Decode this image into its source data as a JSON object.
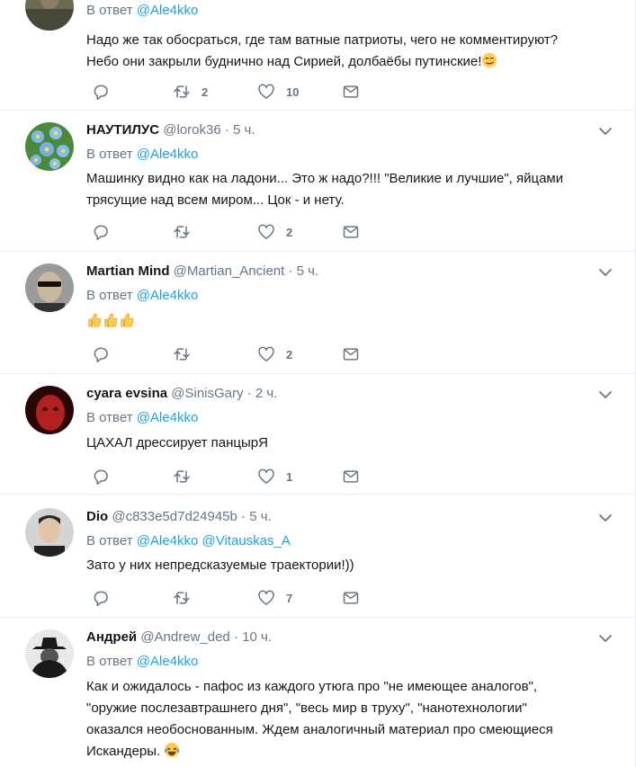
{
  "reply_prefix": "В ответ",
  "tweets": [
    {
      "name": "",
      "handle": "",
      "time": "",
      "mentions": [
        "@Ale4kko"
      ],
      "lines": [
        "Надо же так обосраться, где там ватные патриоты, чего не комментируют?",
        "Небо они закрыли буднично над Сирией,  долбаёбы путинские!"
      ],
      "emoji": "smirk-emoji",
      "retweets": "2",
      "likes": "10",
      "avatar_icon": "soldier-avatar"
    },
    {
      "name": "НАУТИЛУС",
      "handle": "@lorok36",
      "time": "5 ч.",
      "mentions": [
        "@Ale4kko"
      ],
      "lines": [
        "Машинку видно как на ладони... Это ж надо?!!! \"Великие и лучшие\", яйцами",
        "трясущие над всем миром... Цок - и нету."
      ],
      "retweets": "",
      "likes": "2",
      "avatar_icon": "forget-me-not-flowers-avatar"
    },
    {
      "name": "Martian Mind",
      "handle": "@Martian_Ancient",
      "time": "5 ч.",
      "mentions": [
        "@Ale4kko"
      ],
      "lines": [
        ""
      ],
      "emoji": "thumbs-up-emoji-x3",
      "retweets": "",
      "likes": "2",
      "avatar_icon": "sunglasses-man-avatar"
    },
    {
      "name": "cyara evsina",
      "handle": "@SinisGary",
      "time": "2 ч.",
      "mentions": [
        "@Ale4kko"
      ],
      "lines": [
        "ЦАХАЛ дрессирует панцырЯ"
      ],
      "retweets": "",
      "likes": "1",
      "avatar_icon": "red-face-avatar"
    },
    {
      "name": "Dio",
      "handle": "@c833e5d7d24945b",
      "time": "5 ч.",
      "mentions": [
        "@Ale4kko",
        "@Vitauskas_A"
      ],
      "lines": [
        "Зато у них непредсказуемые траектории!))"
      ],
      "retweets": "",
      "likes": "7",
      "avatar_icon": "man-portrait-avatar"
    },
    {
      "name": "Андрей",
      "handle": "@Andrew_ded",
      "time": "10 ч.",
      "mentions": [
        "@Ale4kko"
      ],
      "lines": [
        "Как и ожидалось - пафос из каждого утюга про \"не имеющее аналогов\",",
        "\"оружие послезавтрашнего дня\", \"весь мир в труху\", \"нанотехнологии\"",
        "оказался необоснованным. Ждем аналогичный материал про смеющиеся",
        "Искандеры. "
      ],
      "emoji": "laughing-tears-emoji",
      "avatar_icon": "spy-hat-avatar"
    }
  ],
  "colors": {
    "accent": "#1da1f2",
    "muted": "#657786",
    "text": "#14171a",
    "divider": "#e6ecf0"
  }
}
